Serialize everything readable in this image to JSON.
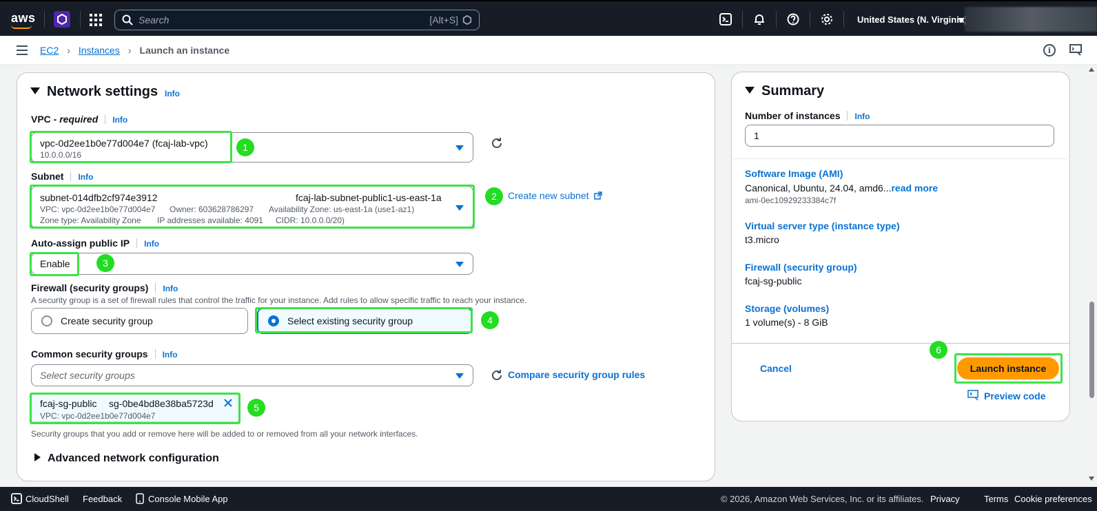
{
  "topnav": {
    "logo": "aws",
    "search_placeholder": "Search",
    "search_shortcut": "[Alt+S]",
    "region": "United States (N. Virginia)",
    "icons": [
      "cloudshell-icon",
      "bell-icon",
      "help-icon",
      "gear-icon"
    ]
  },
  "breadcrumb": {
    "items": [
      "EC2",
      "Instances"
    ],
    "current": "Launch an instance"
  },
  "network": {
    "title": "Network settings",
    "info": "Info",
    "vpc_label": "VPC - ",
    "vpc_required": "required",
    "vpc_value": "vpc-0d2ee1b0e77d004e7 (fcaj-lab-vpc)",
    "vpc_cidr": "10.0.0.0/16",
    "subnet_label": "Subnet",
    "subnet_id": "subnet-014dfb2cf974e3912",
    "subnet_name": "fcaj-lab-subnet-public1-us-east-1a",
    "subnet_vpc": "VPC: vpc-0d2ee1b0e77d004e7",
    "subnet_owner": "Owner: 603628786297",
    "subnet_az": "Availability Zone: us-east-1a (use1-az1)",
    "subnet_zonetype": "Zone type: Availability Zone",
    "subnet_ips": "IP addresses available: 4091",
    "subnet_cidr": "CIDR: 10.0.0.0/20)",
    "create_subnet": "Create new subnet",
    "autoip_label": "Auto-assign public IP",
    "autoip_value": "Enable",
    "firewall_label": "Firewall (security groups)",
    "firewall_desc": "A security group is a set of firewall rules that control the traffic for your instance. Add rules to allow specific traffic to reach your instance.",
    "option_create": "Create security group",
    "option_select": "Select existing security group",
    "common_sg_label": "Common security groups",
    "common_sg_placeholder": "Select security groups",
    "compare_rules": "Compare security group rules",
    "token_name": "fcaj-sg-public",
    "token_id": "sg-0be4bd8e38ba5723d",
    "token_vpc": "VPC: vpc-0d2ee1b0e77d004e7",
    "sg_note": "Security groups that you add or remove here will be added to or removed from all your network interfaces.",
    "advanced": "Advanced network configuration"
  },
  "badges": [
    "1",
    "2",
    "3",
    "4",
    "5",
    "6"
  ],
  "summary": {
    "title": "Summary",
    "num_label": "Number of instances",
    "info": "Info",
    "num_value": "1",
    "ami_h": "Software Image (AMI)",
    "ami_v": "Canonical, Ubuntu, 24.04, amd6...",
    "read_more": "read more",
    "ami_id": "ami-0ec10929233384c7f",
    "type_h": "Virtual server type (instance type)",
    "type_v": "t3.micro",
    "fw_h": "Firewall (security group)",
    "fw_v": "fcaj-sg-public",
    "storage_h": "Storage (volumes)",
    "storage_v": "1 volume(s) - 8 GiB",
    "cancel": "Cancel",
    "launch": "Launch instance",
    "preview": "Preview code"
  },
  "footer": {
    "cloudshell": "CloudShell",
    "feedback": "Feedback",
    "mobile": "Console Mobile App",
    "copyright": "© 2026, Amazon Web Services, Inc. or its affiliates.",
    "privacy": "Privacy",
    "terms": "Terms",
    "cookies": "Cookie preferences"
  },
  "colors": {
    "nav_bg": "#161d26",
    "link": "#0972d3",
    "launch": "#ff9900",
    "highlight": "#3ce24a"
  }
}
